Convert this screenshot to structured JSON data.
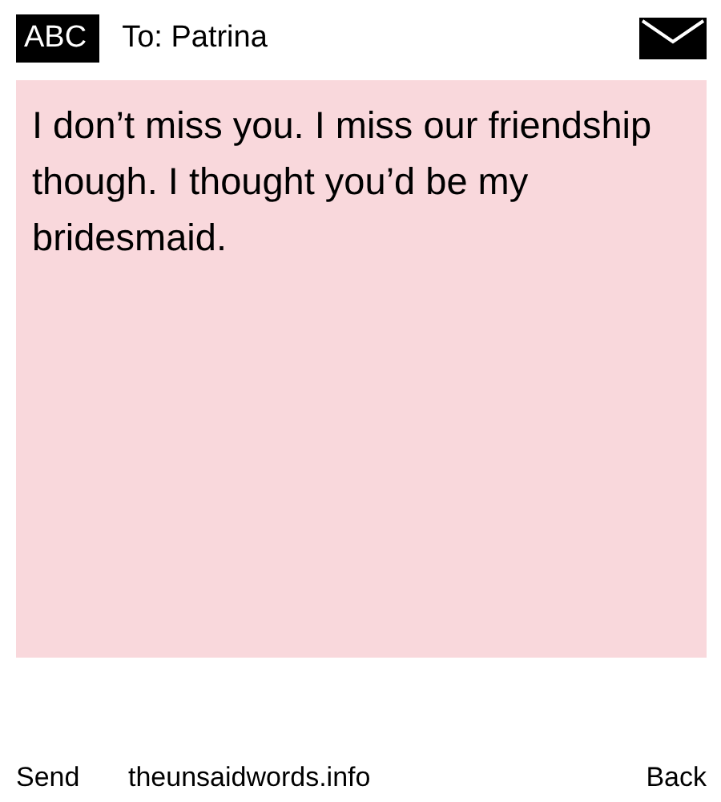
{
  "header": {
    "badge": "ABC",
    "recipient": "To: Patrina"
  },
  "message": "I don’t miss you. I miss our friendship though. I thought you’d be my bridesmaid.",
  "footer": {
    "send": "Send",
    "site": "theunsaidwords.info",
    "back": "Back"
  }
}
